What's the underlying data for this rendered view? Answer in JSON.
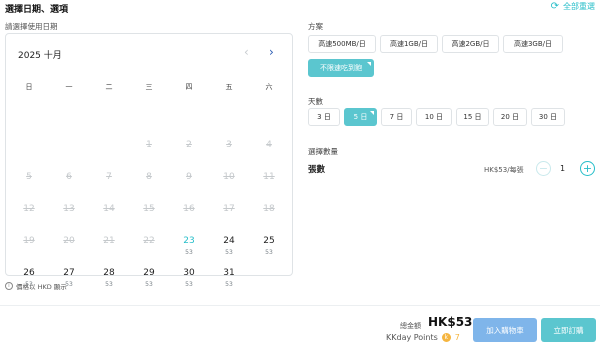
{
  "header": {
    "title": "選擇日期、選項",
    "reset": "全部重選"
  },
  "calendar": {
    "label": "請選擇使用日期",
    "month": "2025 十月",
    "weekdays": [
      "日",
      "一",
      "二",
      "三",
      "四",
      "五",
      "六"
    ],
    "rows": [
      [
        {
          "d": "",
          "p": ""
        },
        {
          "d": "",
          "p": ""
        },
        {
          "d": "",
          "p": ""
        },
        {
          "d": "1",
          "p": ""
        },
        {
          "d": "2",
          "p": ""
        },
        {
          "d": "3",
          "p": ""
        },
        {
          "d": "4",
          "p": ""
        }
      ],
      [
        {
          "d": "5",
          "p": ""
        },
        {
          "d": "6",
          "p": ""
        },
        {
          "d": "7",
          "p": ""
        },
        {
          "d": "8",
          "p": ""
        },
        {
          "d": "9",
          "p": ""
        },
        {
          "d": "10",
          "p": ""
        },
        {
          "d": "11",
          "p": ""
        }
      ],
      [
        {
          "d": "12",
          "p": ""
        },
        {
          "d": "13",
          "p": ""
        },
        {
          "d": "14",
          "p": ""
        },
        {
          "d": "15",
          "p": ""
        },
        {
          "d": "16",
          "p": ""
        },
        {
          "d": "17",
          "p": ""
        },
        {
          "d": "18",
          "p": ""
        }
      ],
      [
        {
          "d": "19",
          "p": ""
        },
        {
          "d": "20",
          "p": ""
        },
        {
          "d": "21",
          "p": ""
        },
        {
          "d": "22",
          "p": ""
        },
        {
          "d": "23",
          "p": "53"
        },
        {
          "d": "24",
          "p": "53"
        },
        {
          "d": "25",
          "p": "53"
        }
      ],
      [
        {
          "d": "26",
          "p": "53"
        },
        {
          "d": "27",
          "p": "53"
        },
        {
          "d": "28",
          "p": "53"
        },
        {
          "d": "29",
          "p": "53"
        },
        {
          "d": "30",
          "p": "53"
        },
        {
          "d": "31",
          "p": "53"
        },
        {
          "d": "",
          "p": ""
        }
      ]
    ],
    "note": "價格以 HKD 顯示"
  },
  "plan": {
    "label": "方案",
    "options": [
      "高速500MB/日",
      "高速1GB/日",
      "高速2GB/日",
      "高速3GB/日",
      "不限速吃到飽"
    ],
    "selected": "不限速吃到飽"
  },
  "days": {
    "label": "天數",
    "options": [
      "3 日",
      "5 日",
      "7 日",
      "10 日",
      "15 日",
      "20 日",
      "30 日"
    ],
    "selected": "5 日"
  },
  "quantity": {
    "label": "選擇數量",
    "item": "張數",
    "unit_price": "HK$53/每張",
    "value": "1"
  },
  "footer": {
    "total_label": "總金額",
    "total_value": "HK$53",
    "points_label": "KKday Points",
    "points_value": "7",
    "cart_button": "加入購物車",
    "book_button": "立即訂購"
  }
}
